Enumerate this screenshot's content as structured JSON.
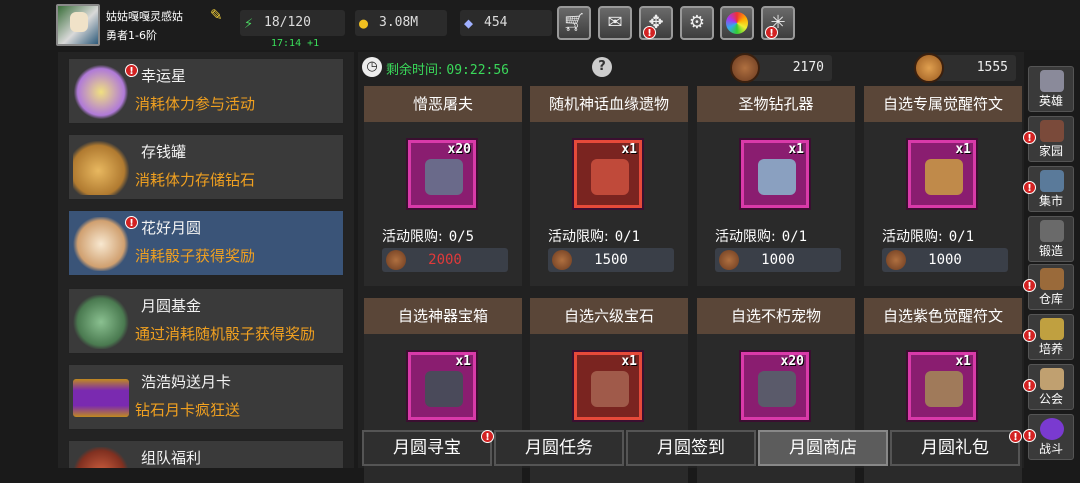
{
  "player": {
    "name": "姑姑嘎嘎灵感姑",
    "rank": "勇者1-6阶"
  },
  "stats": {
    "energy": "18/120",
    "energy_timer": "17:14 +1",
    "gold": "3.08M",
    "gems": "454"
  },
  "toolbar": [
    "shop-cart-icon",
    "mail-icon",
    "gamepad-icon",
    "gear-icon",
    "color-wheel-icon",
    "spider-web-icon"
  ],
  "events": [
    {
      "title": "幸运星",
      "desc": "消耗体力参与活动",
      "icon": "lucky-star-icon",
      "badge": "!",
      "color": "#b07ad8"
    },
    {
      "title": "存钱罐",
      "desc": "消耗体力存储钻石",
      "icon": "piggy-bank-icon",
      "badge": "",
      "color": "#d9a040"
    },
    {
      "title": "花好月圆",
      "desc": "消耗骰子获得奖励",
      "icon": "moon-rabbit-icon",
      "badge": "!",
      "color": "#e6c090"
    },
    {
      "title": "月圆基金",
      "desc": "通过消耗随机骰子获得奖励",
      "icon": "money-bag-icon",
      "badge": "",
      "color": "#6aa070"
    },
    {
      "title": "浩浩妈送月卡",
      "desc": "钻石月卡疯狂送",
      "icon": "card-icon",
      "badge": "",
      "color": "#7a2ab0"
    },
    {
      "title": "组队福利",
      "desc": "",
      "icon": "team-icon",
      "badge": "",
      "color": "#a04030"
    }
  ],
  "shop": {
    "remaining_label": "剩余时间:",
    "remaining_time": "09:22:56",
    "currency_a": "2170",
    "currency_b": "1555",
    "items": [
      {
        "name": "憎恶屠夫",
        "qty": "x20",
        "limit_label": "活动限购:",
        "limit": "0/5",
        "price": "2000",
        "price_red": true,
        "slot": "purple",
        "art": "#6a6a8a"
      },
      {
        "name": "随机神话血缘遗物",
        "qty": "x1",
        "limit_label": "活动限购:",
        "limit": "0/1",
        "price": "1500",
        "price_red": false,
        "slot": "red",
        "art": "#c04a3a"
      },
      {
        "name": "圣物钻孔器",
        "qty": "x1",
        "limit_label": "活动限购:",
        "limit": "0/1",
        "price": "1000",
        "price_red": false,
        "slot": "purple",
        "art": "#8aa0c0"
      },
      {
        "name": "自选专属觉醒符文",
        "qty": "x1",
        "limit_label": "活动限购:",
        "limit": "0/1",
        "price": "1000",
        "price_red": false,
        "slot": "purple",
        "art": "#c08a4a"
      },
      {
        "name": "自选神器宝箱",
        "qty": "x1",
        "slot": "purple",
        "art": "#4a4a5a"
      },
      {
        "name": "自选六级宝石",
        "qty": "x1",
        "slot": "red",
        "art": "#a05a4a"
      },
      {
        "name": "自选不朽宠物",
        "qty": "x20",
        "slot": "purple",
        "art": "#5a5a6a"
      },
      {
        "name": "自选紫色觉醒符文",
        "qty": "x1",
        "slot": "purple",
        "art": "#a07a5a"
      }
    ]
  },
  "tabs": [
    {
      "label": "月圆寻宝",
      "badge": "!",
      "active": false
    },
    {
      "label": "月圆任务",
      "badge": "",
      "active": false
    },
    {
      "label": "月圆签到",
      "badge": "",
      "active": false
    },
    {
      "label": "月圆商店",
      "badge": "",
      "active": true
    },
    {
      "label": "月圆礼包",
      "badge": "!",
      "active": false
    }
  ],
  "nav": [
    {
      "label": "英雄",
      "icon": "helmet-icon",
      "badge": "",
      "color": "#8a8a9a"
    },
    {
      "label": "家园",
      "icon": "castle-icon",
      "badge": "!",
      "color": "#7a4a3a"
    },
    {
      "label": "集市",
      "icon": "market-icon",
      "badge": "!",
      "color": "#5a7a9a"
    },
    {
      "label": "锻造",
      "icon": "anvil-icon",
      "badge": "",
      "color": "#6a6a6a"
    },
    {
      "label": "仓库",
      "icon": "chest-icon",
      "badge": "!",
      "color": "#9a6a3a"
    },
    {
      "label": "培养",
      "icon": "chalice-icon",
      "badge": "!",
      "color": "#c0a040"
    },
    {
      "label": "公会",
      "icon": "guild-icon",
      "badge": "!",
      "color": "#c0a070"
    },
    {
      "label": "战斗",
      "icon": "portal-icon",
      "badge": "!",
      "color": "#7a3ad0"
    }
  ]
}
